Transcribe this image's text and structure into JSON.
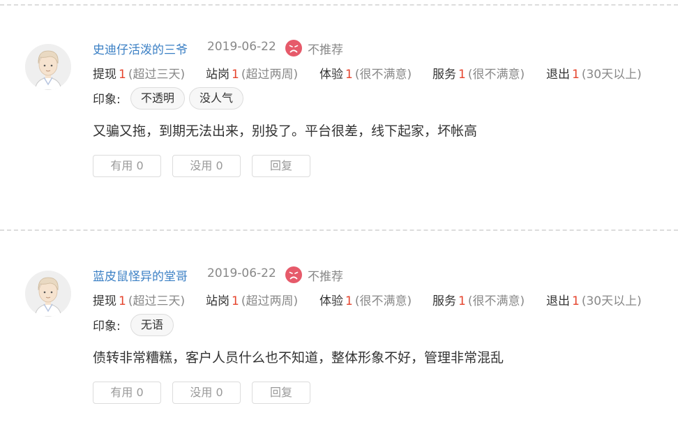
{
  "reviews": [
    {
      "username": "史迪仔活泼的三爷",
      "date": "2019-06-22",
      "recommendation": "不推荐",
      "recommendation_icon": "sad-face-icon",
      "ratings": [
        {
          "label": "提现",
          "score": "1",
          "desc": "(超过三天)"
        },
        {
          "label": "站岗",
          "score": "1",
          "desc": "(超过两周)"
        },
        {
          "label": "体验",
          "score": "1",
          "desc": "(很不满意)"
        },
        {
          "label": "服务",
          "score": "1",
          "desc": "(很不满意)"
        },
        {
          "label": "退出",
          "score": "1",
          "desc": "(30天以上)"
        }
      ],
      "impression_label": "印象:",
      "tags": [
        "不透明",
        "没人气"
      ],
      "content": "又骗又拖，到期无法出来，别投了。平台很差，线下起家，坏帐高",
      "actions": {
        "useful": "有用 0",
        "useless": "没用 0",
        "reply": "回复"
      }
    },
    {
      "username": "蓝皮鼠怪异的堂哥",
      "date": "2019-06-22",
      "recommendation": "不推荐",
      "recommendation_icon": "sad-face-icon",
      "ratings": [
        {
          "label": "提现",
          "score": "1",
          "desc": "(超过三天)"
        },
        {
          "label": "站岗",
          "score": "1",
          "desc": "(超过两周)"
        },
        {
          "label": "体验",
          "score": "1",
          "desc": "(很不满意)"
        },
        {
          "label": "服务",
          "score": "1",
          "desc": "(很不满意)"
        },
        {
          "label": "退出",
          "score": "1",
          "desc": "(30天以上)"
        }
      ],
      "impression_label": "印象:",
      "tags": [
        "无语"
      ],
      "content": "债转非常糟糕，客户人员什么也不知道，整体形象不好，管理非常混乱",
      "actions": {
        "useful": "有用 0",
        "useless": "没用 0",
        "reply": "回复"
      }
    }
  ],
  "colors": {
    "username": "#3a7fc4",
    "score": "#e5432c",
    "muted": "#888888",
    "sad_icon": "#e65a6a"
  }
}
